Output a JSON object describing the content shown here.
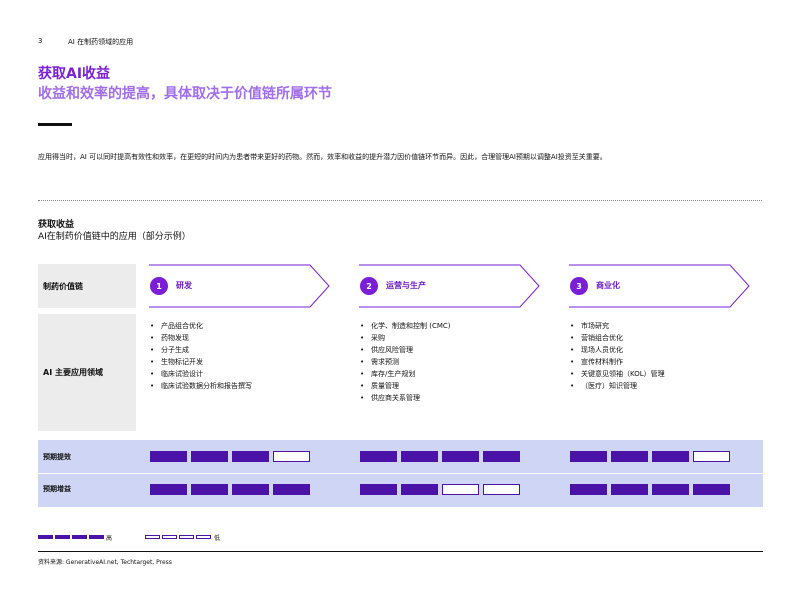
{
  "header": {
    "page_number": "3",
    "running_title": "AI 在制药领域的应用"
  },
  "title": {
    "line1": "获取AI收益",
    "line2": "收益和效率的提高，具体取决于价值链所属环节"
  },
  "intro": "应用得当时，AI 可以同时提高有效性和效率，在更短的时间内为患者带来更好的药物。然而，效率和收益的提升潜力因价值链环节而异。因此，合理管理AI预期以调整AI投资至关重要。",
  "section": {
    "title": "获取收益",
    "subtitle": "AI在制药价值链中的应用（部分示例）"
  },
  "row_labels": {
    "value_chain": "制药价值链",
    "applications": "AI 主要应用领域",
    "efficiency": "预期提效",
    "gain": "预期增益"
  },
  "stages": [
    {
      "number": "1",
      "title": "研发",
      "applications": [
        "产品组合优化",
        "药物发现",
        "分子生成",
        "生物标记开发",
        "临床试验设计",
        "临床试验数据分析和报告撰写"
      ],
      "efficiency": 3,
      "gain": 4
    },
    {
      "number": "2",
      "title": "运营与生产",
      "applications": [
        "化学、制造和控制 (CMC)",
        "采购",
        "供应风险管理",
        "需求预测",
        "库存/生产规划",
        "质量管理",
        "供应商关系管理"
      ],
      "efficiency": 4,
      "gain": 2
    },
    {
      "number": "3",
      "title": "商业化",
      "applications": [
        "市场研究",
        "营销组合优化",
        "现场人员优化",
        "宣传材料制作",
        "关键意见领袖（KOL）管理",
        "（医疗）知识管理"
      ],
      "efficiency": 3,
      "gain": 4
    }
  ],
  "rating_max": 4,
  "legend": {
    "high": "高",
    "low": "低"
  },
  "source": "资料来源: GenerativeAI.net, Techtarget, Press",
  "colors": {
    "accent": "#7a1fd6",
    "accent_light": "#a06ee8",
    "block": "#4b12a8",
    "band": "#cfd6f5"
  }
}
